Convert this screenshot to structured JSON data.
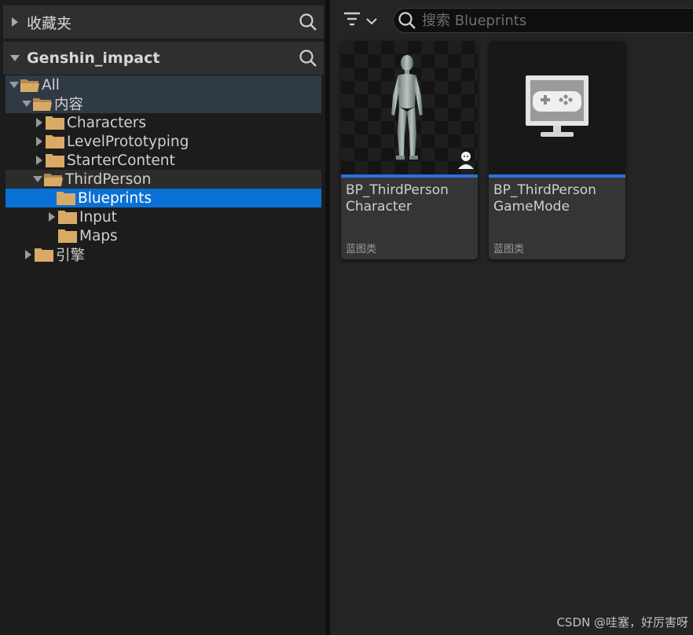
{
  "favorites": {
    "title": "收藏夹"
  },
  "project": {
    "title": "Genshin_impact"
  },
  "tree": {
    "items": [
      {
        "label": "All"
      },
      {
        "label": "内容"
      },
      {
        "label": "Characters"
      },
      {
        "label": "LevelPrototyping"
      },
      {
        "label": "StarterContent"
      },
      {
        "label": "ThirdPerson"
      },
      {
        "label": "Blueprints"
      },
      {
        "label": "Input"
      },
      {
        "label": "Maps"
      },
      {
        "label": "引擎"
      }
    ]
  },
  "search": {
    "placeholder": "搜索 Blueprints",
    "value": ""
  },
  "assets": [
    {
      "name_line1": "BP_ThirdPerson",
      "name_line2": "Character",
      "type": "蓝图类",
      "icon": "mannequin-thumbnail"
    },
    {
      "name_line1": "BP_ThirdPerson",
      "name_line2": "GameMode",
      "type": "蓝图类",
      "icon": "gamemode-monitor-thumbnail"
    }
  ],
  "colors": {
    "selection": "#0a70d6",
    "accent_bar": "#2e6fe0",
    "panel": "#1c1c1c"
  },
  "watermark": "CSDN @哇塞，好厉害呀"
}
